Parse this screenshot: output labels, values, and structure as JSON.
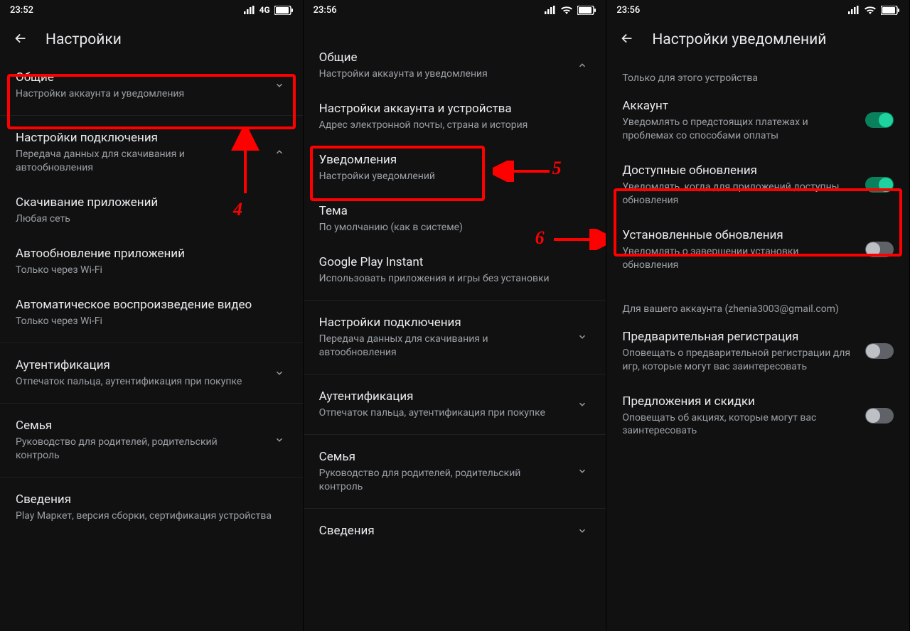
{
  "phone1": {
    "time": "23:52",
    "net": "4G",
    "header": "Настройки",
    "items": [
      {
        "title": "Общие",
        "sub": "Настройки аккаунта и уведомления",
        "chev": "down"
      },
      {
        "title": "Настройки подключения",
        "sub": "Передача данных для скачивания и автообновления",
        "chev": "up"
      },
      {
        "title": "Скачивание приложений",
        "sub": "Любая сеть"
      },
      {
        "title": "Автообновление приложений",
        "sub": "Только через Wi-Fi"
      },
      {
        "title": "Автоматическое воспроизведение видео",
        "sub": "Только через Wi-Fi"
      },
      {
        "title": "Аутентификация",
        "sub": "Отпечаток пальца, аутентификация при покупке",
        "chev": "down"
      },
      {
        "title": "Семья",
        "sub": "Руководство для родителей, родительский контроль",
        "chev": "down"
      },
      {
        "title": "Сведения",
        "sub": "Play Маркет, версия сборки, сертификация устройства"
      }
    ],
    "anno_num": "4"
  },
  "phone2": {
    "time": "23:56",
    "items": [
      {
        "title": "Общие",
        "sub": "Настройки аккаунта и уведомления",
        "chev": "up"
      },
      {
        "title": "Настройки аккаунта и устройства",
        "sub": "Адрес электронной почты, страна и история"
      },
      {
        "title": "Уведомления",
        "sub": "Настройки уведомлений"
      },
      {
        "title": "Тема",
        "sub": "По умолчанию (как в системе)"
      },
      {
        "title": "Google Play Instant",
        "sub": "Использовать приложения и игры без установки"
      },
      {
        "title": "Настройки подключения",
        "sub": "Передача данных для скачивания и автообновления",
        "chev": "down"
      },
      {
        "title": "Аутентификация",
        "sub": "Отпечаток пальца, аутентификация при покупке",
        "chev": "down"
      },
      {
        "title": "Семья",
        "sub": "Руководство для родителей, родительский контроль",
        "chev": "down"
      },
      {
        "title": "Сведения"
      }
    ],
    "anno_num5": "5",
    "anno_num6": "6"
  },
  "phone3": {
    "time": "23:56",
    "header": "Настройки уведомлений",
    "note1": "Только для этого устройства",
    "items_device": [
      {
        "title": "Аккаунт",
        "sub": "Уведомлять о предстоящих платежах и проблемах со способами оплаты",
        "on": true
      },
      {
        "title": "Доступные обновления",
        "sub": "Уведомлять, когда для приложений доступны обновления",
        "on": true
      },
      {
        "title": "Установленные обновления",
        "sub": "Уведомлять о завершении установки обновления",
        "on": false
      }
    ],
    "note2": "Для вашего аккаунта (zhenia3003@gmail.com)",
    "items_account": [
      {
        "title": "Предварительная регистрация",
        "sub": "Оповещать о предварительной регистрации для игр, которые могут вас заинтересовать",
        "on": false
      },
      {
        "title": "Предложения и скидки",
        "sub": "Оповещать об акциях, которые могут вас заинтересовать",
        "on": false
      }
    ]
  }
}
